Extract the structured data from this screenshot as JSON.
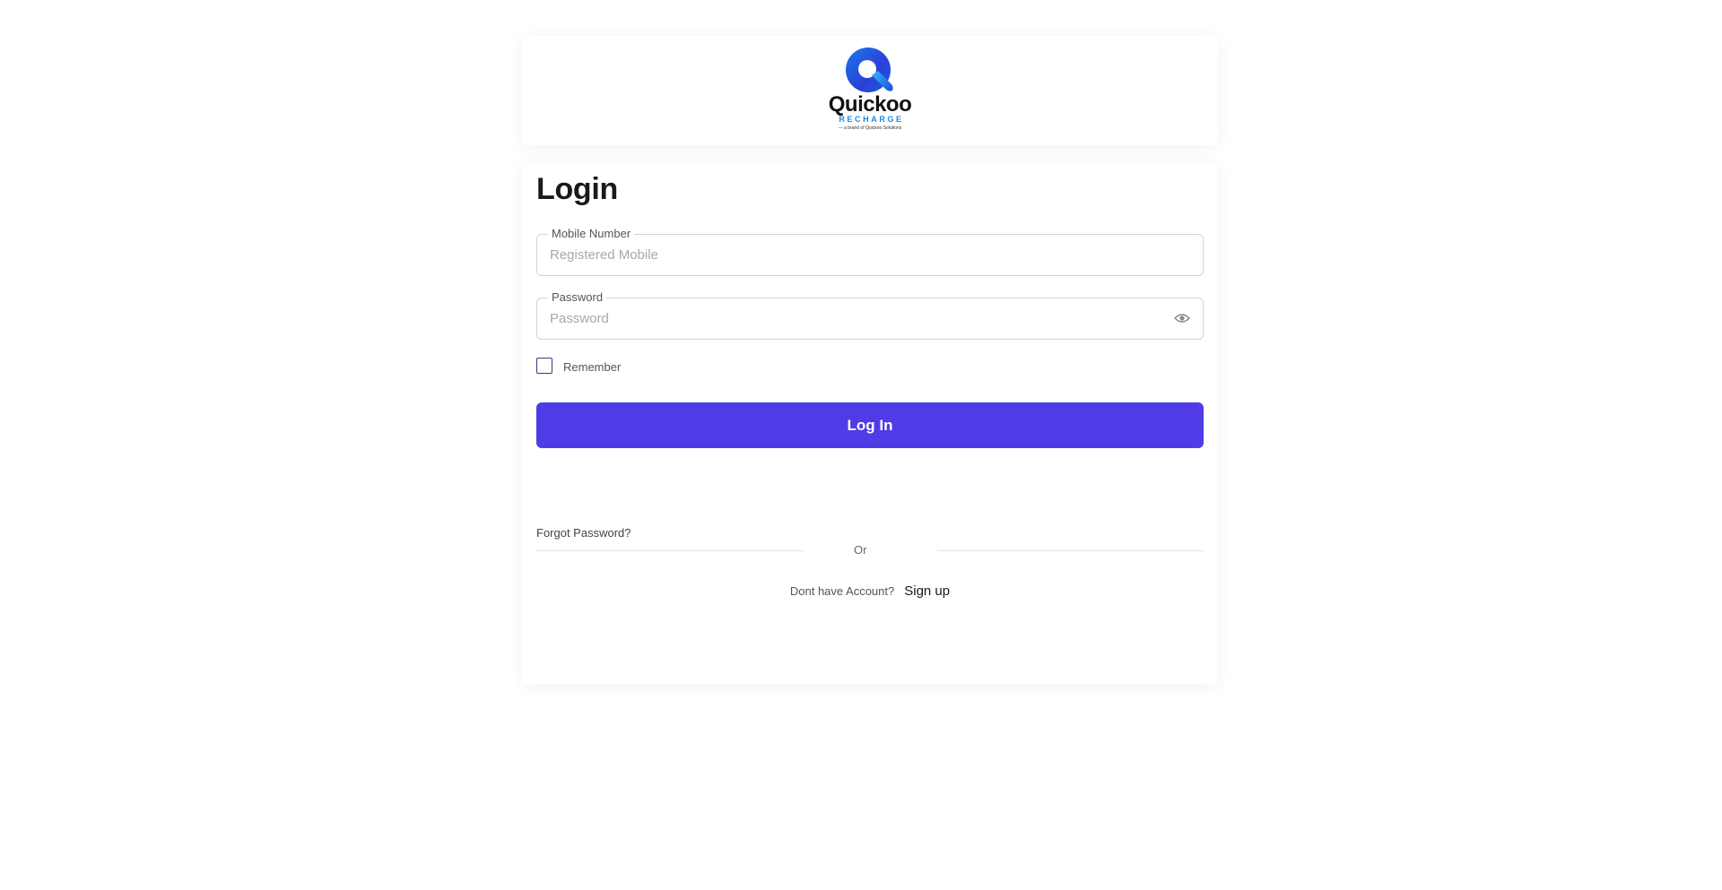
{
  "brand": {
    "name": "Quickoo",
    "sub": "RECHARGE",
    "tagline": "— a brand of Quickoo Solutions",
    "accent": "#1e88e5"
  },
  "login": {
    "title": "Login",
    "mobile": {
      "label": "Mobile Number",
      "placeholder": "Registered Mobile",
      "value": ""
    },
    "password": {
      "label": "Password",
      "placeholder": "Password",
      "value": ""
    },
    "remember_label": "Remember",
    "remember_checked": false,
    "submit_label": "Log In",
    "submit_color": "#4f3ce6",
    "forgot_label": "Forgot Password?",
    "or_label": "Or",
    "signup_prompt": "Dont have Account?",
    "signup_label": "Sign up"
  },
  "icons": {
    "password_toggle": "eye-icon"
  }
}
